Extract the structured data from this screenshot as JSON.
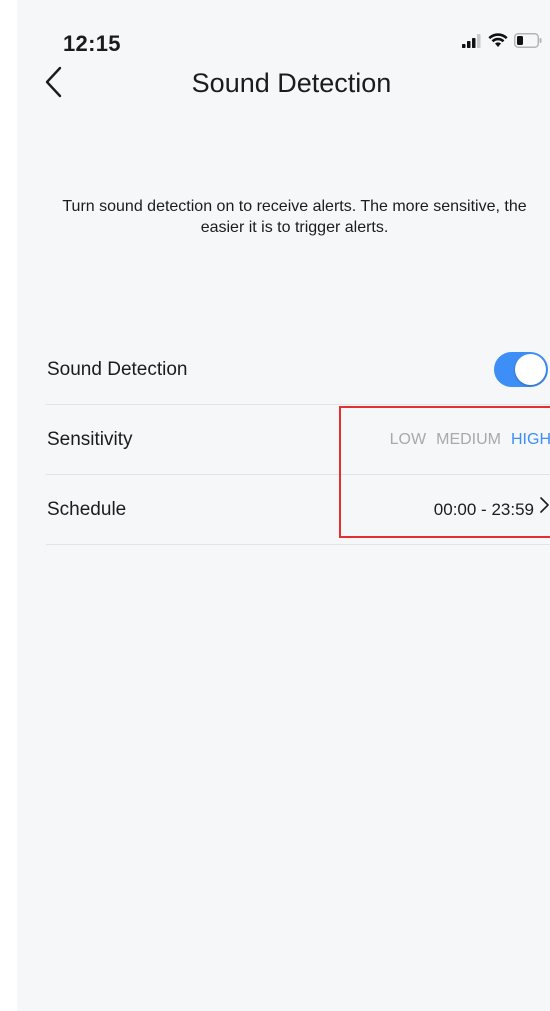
{
  "status_bar": {
    "time": "12:15",
    "icons": [
      "signal-icon",
      "wifi-icon",
      "battery-icon"
    ]
  },
  "nav": {
    "back_icon": "chevron-left-icon",
    "title": "Sound Detection"
  },
  "description": "Turn sound detection on to receive alerts. The more sensitive, the easier it is to trigger alerts.",
  "settings": {
    "sound_detection": {
      "label": "Sound Detection",
      "enabled": true
    },
    "sensitivity": {
      "label": "Sensitivity",
      "options": [
        "LOW",
        "MEDIUM",
        "HIGH"
      ],
      "selected": "HIGH"
    },
    "schedule": {
      "label": "Schedule",
      "value": "00:00 - 23:59",
      "chevron_icon": "chevron-right-icon"
    }
  },
  "colors": {
    "accent": "#3e8ef7",
    "inactive_option": "#a7a9ad",
    "background": "#f6f7f9",
    "highlight_border": "#e2312f"
  }
}
